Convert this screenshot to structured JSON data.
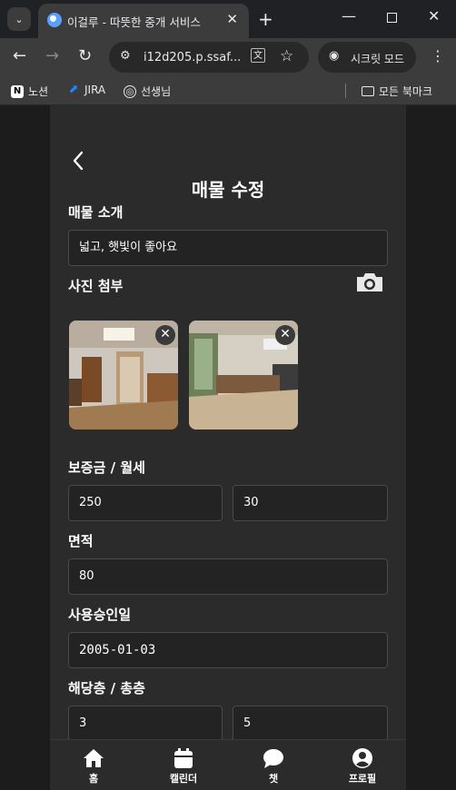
{
  "browser": {
    "tab_title": "이걸루 - 따뜻한 중개 서비스",
    "url": "i12d205.p.ssaf...",
    "incognito_label": "시크릿 모드",
    "bookmarks": [
      "노션",
      "JIRA",
      "선생님"
    ],
    "all_bookmarks": "모든 북마크"
  },
  "page": {
    "title": "매물 수정",
    "intro_label": "매물 소개",
    "intro_value": "넓고, 햇빛이 좋아요",
    "photo_label": "사진 첨부",
    "deposit_label": "보증금 / 월세",
    "deposit_value": "250",
    "monthly_value": "30",
    "area_label": "면적",
    "area_value": "80",
    "approval_label": "사용승인일",
    "approval_value": "2005-01-03",
    "floor_label": "해당층 / 총층",
    "floor_value": "3",
    "total_floor_value": "5"
  },
  "bottom_nav": [
    "홈",
    "캘린더",
    "챗",
    "프로필"
  ],
  "icons": [
    "search-tabs-icon",
    "close-icon",
    "plus-icon",
    "minimize-icon",
    "maximize-icon",
    "back-icon",
    "forward-icon",
    "reload-icon",
    "site-settings-icon",
    "translate-icon",
    "star-icon",
    "incognito-icon",
    "more-icon",
    "folder-icon",
    "chevron-left-icon",
    "camera-icon",
    "home-icon",
    "calendar-icon",
    "chat-icon",
    "profile-icon"
  ]
}
